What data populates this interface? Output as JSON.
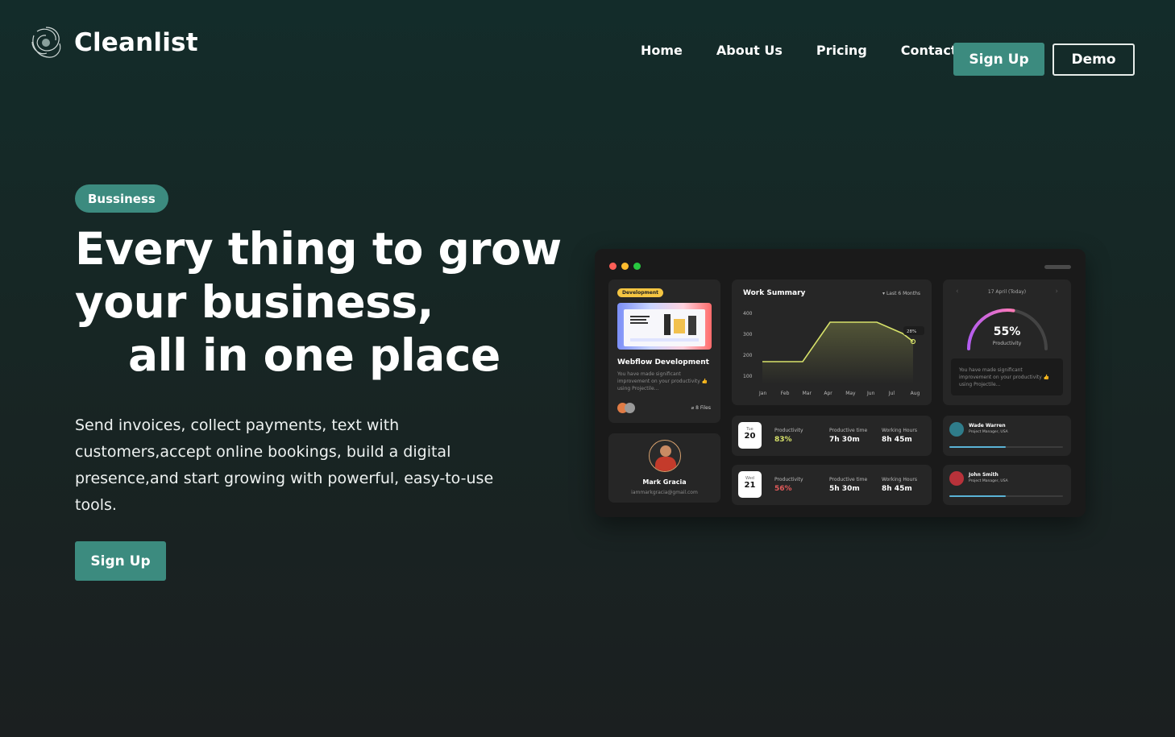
{
  "brand": {
    "name": "Cleanlist"
  },
  "nav": {
    "items": [
      "Home",
      "About Us",
      "Pricing",
      "Contact"
    ],
    "signup_label": "Sign Up",
    "demo_label": "Demo"
  },
  "hero": {
    "badge": "Bussiness",
    "headline_line1": "Every thing to grow",
    "headline_line2": "your business,",
    "headline_line3": "all in one place",
    "subtext": "Send invoices, collect payments, text with customers,accept online bookings, build a digital presence,and start growing with powerful, easy-to-use tools.",
    "cta_label": "Sign Up"
  },
  "dashboard": {
    "project_card": {
      "tag": "Development",
      "title": "Webflow Development",
      "description": "You have made significant improvement on your productivity 👍 using Projectile...",
      "files": "8 Files"
    },
    "profile_card": {
      "name": "Mark Gracia",
      "email": "iammarkgracia@gmail.com"
    },
    "work_summary": {
      "title": "Work Summary",
      "range": "Last 6 Months",
      "y_ticks": [
        "400",
        "300",
        "200",
        "100"
      ],
      "x_ticks": [
        "Jan",
        "Feb",
        "Mar",
        "Apr",
        "May",
        "Jun",
        "Jul",
        "Aug"
      ],
      "callout": "28% "
    },
    "productivity_card": {
      "date": "17 April (Today)",
      "percent": "55%",
      "label": "Productivity",
      "value": 0.55,
      "note": "You have made significant improvement on your productivity 👍 using Projectile..."
    },
    "day_rows": [
      {
        "day": "Tue",
        "date": "20",
        "prod_label": "Productivity",
        "prod": "83%",
        "prod_color": "#d7e26a",
        "time_label": "Productive time",
        "time": "7h 30m",
        "hours_label": "Working Hours",
        "hours": "8h 45m"
      },
      {
        "day": "Wed",
        "date": "21",
        "prod_label": "Productivity",
        "prod": "56%",
        "prod_color": "#e05a5a",
        "time_label": "Productive time",
        "time": "5h 30m",
        "hours_label": "Working Hours",
        "hours": "8h 45m"
      }
    ],
    "people": [
      {
        "name": "Wade Warren",
        "role": "Project Manager, USA"
      },
      {
        "name": "John Smith",
        "role": "Project Manager, USA"
      }
    ]
  },
  "colors": {
    "accent": "#3c8b7f",
    "bg_top": "#132c2a",
    "bg_bottom": "#1b1f20",
    "chart_line": "#d7e26a"
  }
}
